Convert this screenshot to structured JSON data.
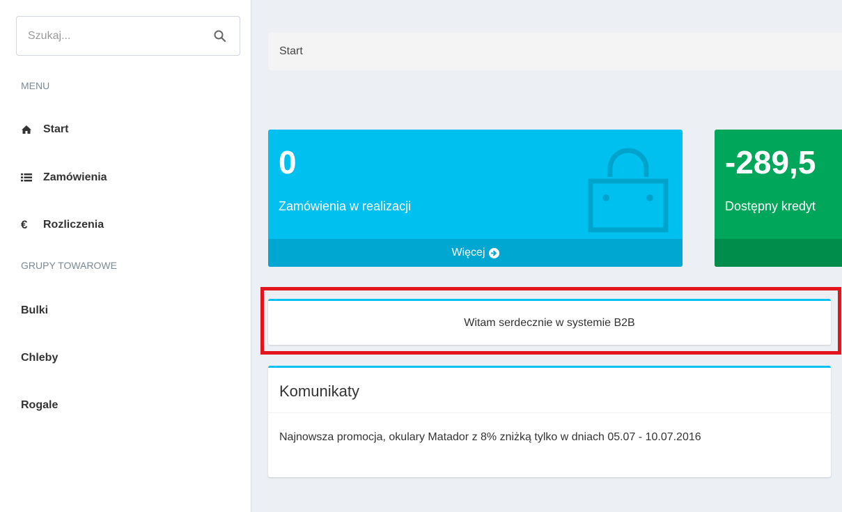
{
  "sidebar": {
    "search": {
      "placeholder": "Szukaj..."
    },
    "menu_header": "MENU",
    "nav": [
      {
        "label": "Start",
        "icon": "home-icon"
      },
      {
        "label": "Zamówienia",
        "icon": "list-icon"
      },
      {
        "label": "Rozliczenia",
        "icon": "euro-icon"
      }
    ],
    "groups_header": "GRUPY TOWAROWE",
    "groups": [
      "Bulki",
      "Chleby",
      "Rogale"
    ]
  },
  "breadcrumb": {
    "current": "Start"
  },
  "boxes": [
    {
      "value": "0",
      "label": "Zamówienia w realizacji",
      "footer": "Więcej",
      "color": "#00c0ef",
      "icon": "shopping-bag-icon"
    },
    {
      "value": "-289,5",
      "label": "Dostępny kredyt",
      "footer": "",
      "color": "#00a65a"
    }
  ],
  "welcome": "Witam serdecznie w systemie B2B",
  "news": {
    "title": "Komunikaty",
    "body": "Najnowsza promocja, okulary Matador z 8% zniżką tylko w dniach 05.07 - 10.07.2016"
  },
  "colors": {
    "accent": "#00c0ef",
    "green": "#00a65a",
    "highlight": "#e3141b"
  }
}
